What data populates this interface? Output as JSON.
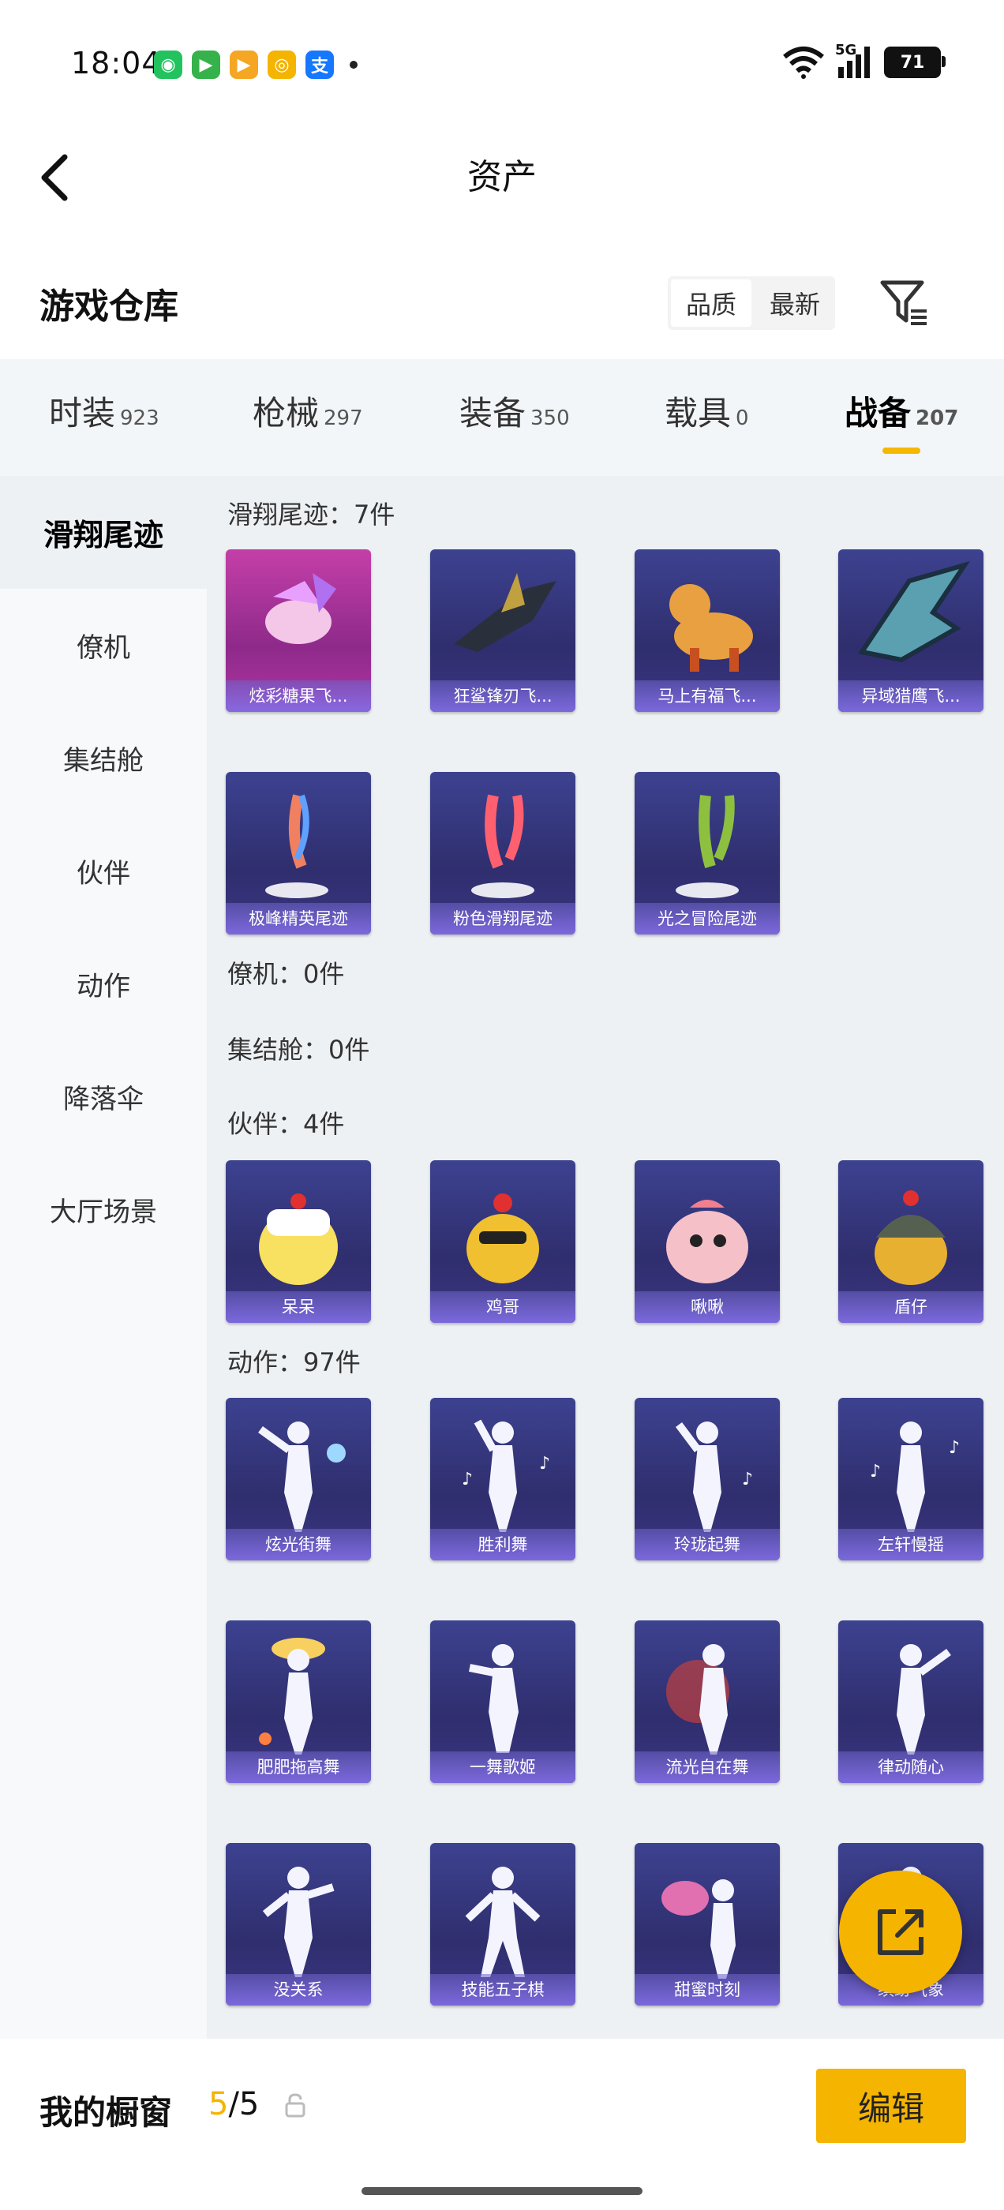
{
  "status": {
    "time": "18:04",
    "network": "5G",
    "battery": "71",
    "app_icons": [
      {
        "name": "wechat-icon",
        "glyph": "◉",
        "color": "#22c35e"
      },
      {
        "name": "video-app-icon",
        "glyph": "▶",
        "color": "#35b24a"
      },
      {
        "name": "youku-icon",
        "glyph": "▶",
        "color": "#f5a623"
      },
      {
        "name": "weibo-icon",
        "glyph": "◎",
        "color": "#f4b400"
      },
      {
        "name": "alipay-icon",
        "glyph": "支",
        "color": "#1677ff"
      }
    ]
  },
  "header": {
    "title": "资产"
  },
  "warehouse": {
    "title": "游戏仓库",
    "sort": {
      "quality": "品质",
      "latest": "最新"
    }
  },
  "tabs": [
    {
      "label": "时装",
      "count": "923"
    },
    {
      "label": "枪械",
      "count": "297"
    },
    {
      "label": "装备",
      "count": "350"
    },
    {
      "label": "载具",
      "count": "0"
    },
    {
      "label": "战备",
      "count": "207",
      "active": true
    }
  ],
  "sidebar": [
    {
      "label": "滑翔尾迹",
      "active": true
    },
    {
      "label": "僚机"
    },
    {
      "label": "集结舱"
    },
    {
      "label": "伙伴"
    },
    {
      "label": "动作"
    },
    {
      "label": "降落伞"
    },
    {
      "label": "大厅场景"
    }
  ],
  "sections": {
    "trail": "滑翔尾迹：7件",
    "wingman": "僚机：0件",
    "pod": "集结舱：0件",
    "partner": "伙伴：4件",
    "emote": "动作：97件"
  },
  "items": {
    "trail": [
      "炫彩糖果飞...",
      "狂鲨锋刃飞...",
      "马上有福飞...",
      "异域猎鹰飞...",
      "极峰精英尾迹",
      "粉色滑翔尾迹",
      "光之冒险尾迹"
    ],
    "partner": [
      "呆呆",
      "鸡哥",
      "啾啾",
      "盾仔"
    ],
    "emote": [
      "炫光街舞",
      "胜利舞",
      "玲珑起舞",
      "左轩慢摇",
      "肥肥拖高舞",
      "一舞歌姬",
      "流光自在舞",
      "律动随心",
      "没关系",
      "技能五子棋",
      "甜蜜时刻",
      "缤纷气象"
    ]
  },
  "footer": {
    "title": "我的橱窗",
    "count_current": "5",
    "count_total": "/5",
    "edit_label": "编辑"
  },
  "colors": {
    "accent": "#f5b400",
    "card": "#34327a",
    "card_highlight": "#b4389e"
  }
}
